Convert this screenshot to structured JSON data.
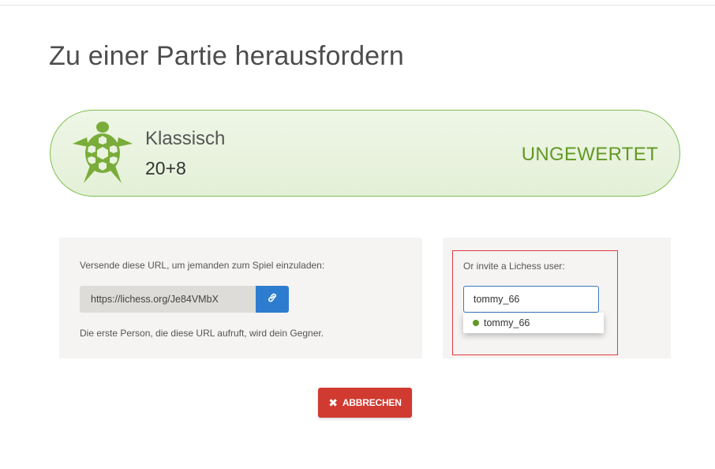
{
  "page": {
    "title": "Zu einer Partie herausfordern"
  },
  "game": {
    "variant": "Klassisch",
    "time_control": "20+8",
    "mode": "UNGEWERTET",
    "variant_icon": "turtle-icon",
    "accent_color": "#629924"
  },
  "url_share": {
    "instruction": "Versende diese URL, um jemanden zum Spiel einzuladen:",
    "url": "https://lichess.org/Je84VMbX",
    "copy_icon": "link-icon",
    "hint": "Die erste Person, die diese URL aufruft, wird dein Gegner."
  },
  "invite": {
    "label": "Or invite a Lichess user:",
    "input_value": "tommy_66",
    "suggestions": [
      {
        "username": "tommy_66",
        "status": "online"
      }
    ]
  },
  "actions": {
    "cancel_label": "ABBRECHEN",
    "cancel_icon": "close-icon",
    "cancel_color": "#d13a30"
  }
}
